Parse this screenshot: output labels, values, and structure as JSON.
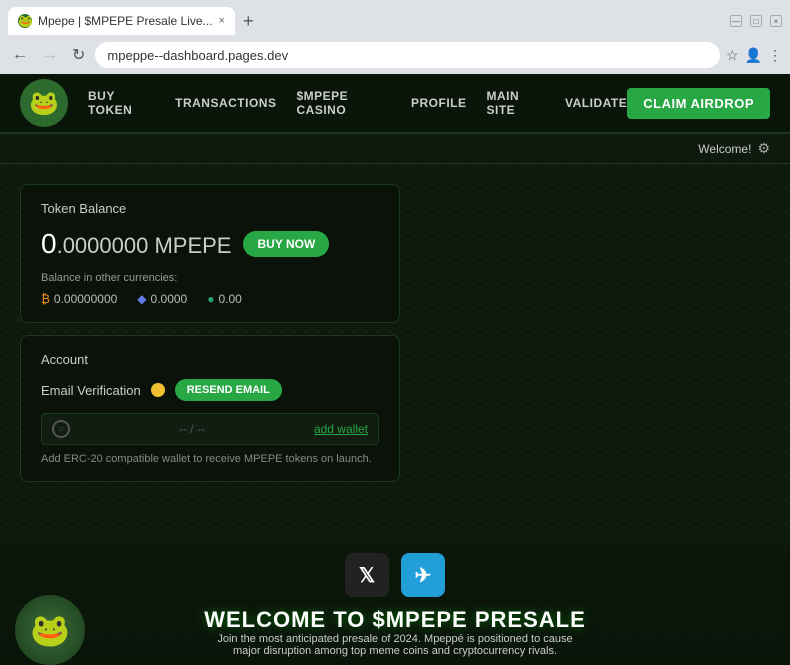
{
  "browser": {
    "tab_favicon": "🐸",
    "tab_title": "Mpepe | $MPEPE Presale Live...",
    "tab_close": "×",
    "new_tab": "+",
    "address": "mpeppe--dashboard.pages.dev",
    "controls": [
      "—",
      "□",
      "×"
    ]
  },
  "nav": {
    "logo_emoji": "🐸",
    "links": [
      {
        "label": "BUY TOKEN"
      },
      {
        "label": "TRANSACTIONS"
      },
      {
        "label": "$MPEPE CASINO"
      },
      {
        "label": "PROFILE"
      },
      {
        "label": "MAIN SITE"
      },
      {
        "label": "VALIDATE"
      }
    ],
    "cta_label": "CLAIM AIRDROP"
  },
  "welcome_bar": {
    "text": "Welcome!",
    "icon": "⚙"
  },
  "token_balance": {
    "title": "Token Balance",
    "zero": "0",
    "decimals": ".0000000 MPEPE",
    "buy_now": "BUY NOW",
    "currencies_label": "Balance in other currencies:",
    "btc": "0.00000000",
    "eth": "0.0000",
    "usdt": "0.00"
  },
  "account": {
    "title": "Account",
    "email_label": "Email Verification",
    "resend_label": "RESEND EMAIL",
    "wallet_separator": "-- / --",
    "add_wallet": "add wallet",
    "wallet_note": "Add ERC-20 compatible wallet to receive MPEPE tokens on launch."
  },
  "social": {
    "x_label": "𝕏",
    "telegram_label": "✈"
  },
  "presale": {
    "heading": "WELCOME TO $MPEPE PRESALE",
    "subtext_line1": "Join the most anticipated presale of 2024. Mpeppé is positioned to cause",
    "subtext_line2": "major disruption among top meme coins and cryptocurrency rivals."
  }
}
